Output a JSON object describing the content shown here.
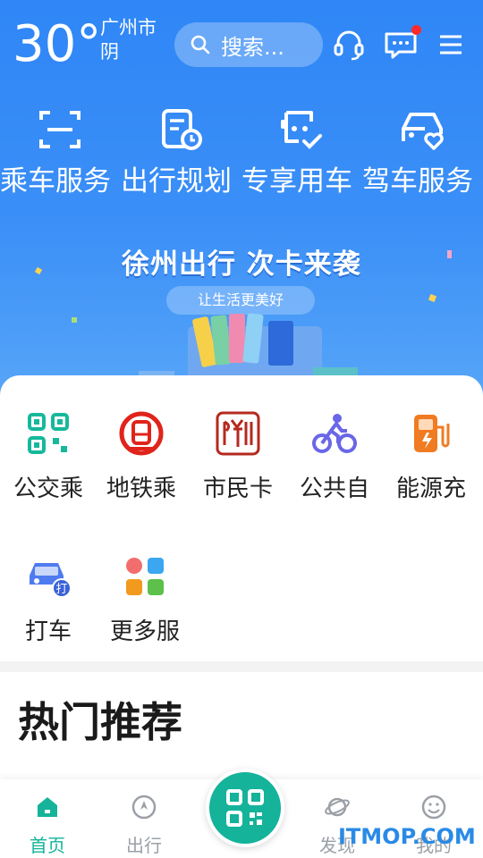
{
  "weather": {
    "temperature": "30°",
    "city": "广州市",
    "condition": "阴"
  },
  "search": {
    "placeholder": "搜索..."
  },
  "services": [
    {
      "label": "乘车服务",
      "icon": "scan-frame-icon"
    },
    {
      "label": "出行规划",
      "icon": "schedule-icon"
    },
    {
      "label": "专享用车",
      "icon": "car-check-icon"
    },
    {
      "label": "驾车服务",
      "icon": "car-heart-icon"
    }
  ],
  "banner": {
    "title": "徐州出行 次卡来袭",
    "subtitle": "让生活更美好"
  },
  "apps": [
    {
      "label": "公交乘",
      "icon": "qr-code-icon",
      "color": "#16b89b"
    },
    {
      "label": "地铁乘",
      "icon": "metro-icon",
      "color": "#e0241b"
    },
    {
      "label": "市民卡",
      "icon": "seal-icon",
      "color": "#b42a1e"
    },
    {
      "label": "公共自",
      "icon": "bicycle-icon",
      "color": "#6a66e8"
    },
    {
      "label": "能源充",
      "icon": "charging-station-icon",
      "color": "#f07b23"
    },
    {
      "label": "打车",
      "icon": "taxi-icon",
      "color": "#4f7bf0"
    },
    {
      "label": "更多服",
      "icon": "grid-icon",
      "color": "#f26d6d"
    }
  ],
  "section": {
    "title": "热门推荐"
  },
  "tabs": [
    {
      "label": "首页",
      "icon": "home-icon",
      "active": true
    },
    {
      "label": "出行",
      "icon": "compass-icon",
      "active": false
    },
    {
      "label": "发现",
      "icon": "planet-icon",
      "active": false
    },
    {
      "label": "我的",
      "icon": "smile-icon",
      "active": false
    }
  ],
  "watermark": "ITMOP.COM",
  "colors": {
    "primary": "#2f86f6",
    "accent": "#14b39a",
    "notification": "#ff2b2b"
  }
}
